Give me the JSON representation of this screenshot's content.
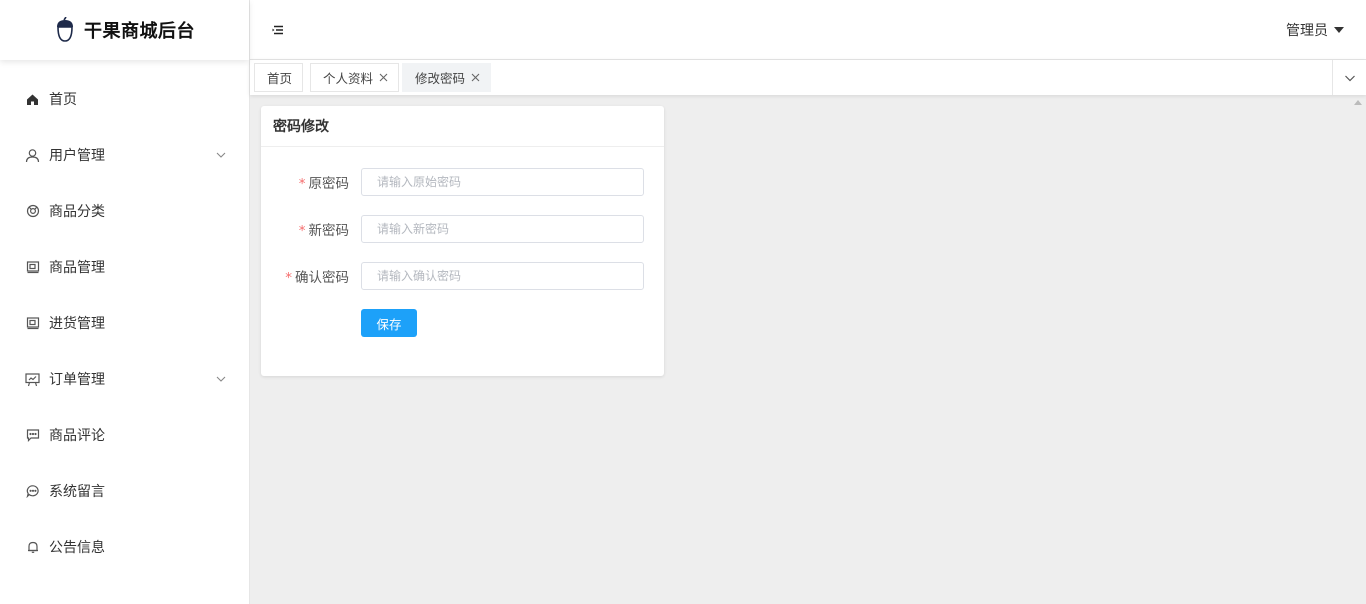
{
  "app": {
    "title": "干果商城后台"
  },
  "sidebar": {
    "items": [
      {
        "label": "首页",
        "icon": "home-icon",
        "has_submenu": false
      },
      {
        "label": "用户管理",
        "icon": "user-icon",
        "has_submenu": true
      },
      {
        "label": "商品分类",
        "icon": "category-icon",
        "has_submenu": false
      },
      {
        "label": "商品管理",
        "icon": "goods-icon",
        "has_submenu": false
      },
      {
        "label": "进货管理",
        "icon": "stock-icon",
        "has_submenu": false
      },
      {
        "label": "订单管理",
        "icon": "order-icon",
        "has_submenu": true
      },
      {
        "label": "商品评论",
        "icon": "comment-icon",
        "has_submenu": false
      },
      {
        "label": "系统留言",
        "icon": "message-icon",
        "has_submenu": false
      },
      {
        "label": "公告信息",
        "icon": "bell-icon",
        "has_submenu": false
      }
    ]
  },
  "header": {
    "user_label": "管理员"
  },
  "tabs": [
    {
      "label": "首页",
      "closable": false,
      "active": false
    },
    {
      "label": "个人资料",
      "closable": true,
      "active": false
    },
    {
      "label": "修改密码",
      "closable": true,
      "active": true
    }
  ],
  "form": {
    "title": "密码修改",
    "fields": [
      {
        "label": "原密码",
        "placeholder": "请输入原始密码",
        "value": "",
        "required": true
      },
      {
        "label": "新密码",
        "placeholder": "请输入新密码",
        "value": "",
        "required": true
      },
      {
        "label": "确认密码",
        "placeholder": "请输入确认密码",
        "value": "",
        "required": true
      }
    ],
    "save_label": "保存"
  },
  "colors": {
    "primary": "#1da1f9",
    "required": "#f56c6c",
    "background": "#eeeeee"
  }
}
